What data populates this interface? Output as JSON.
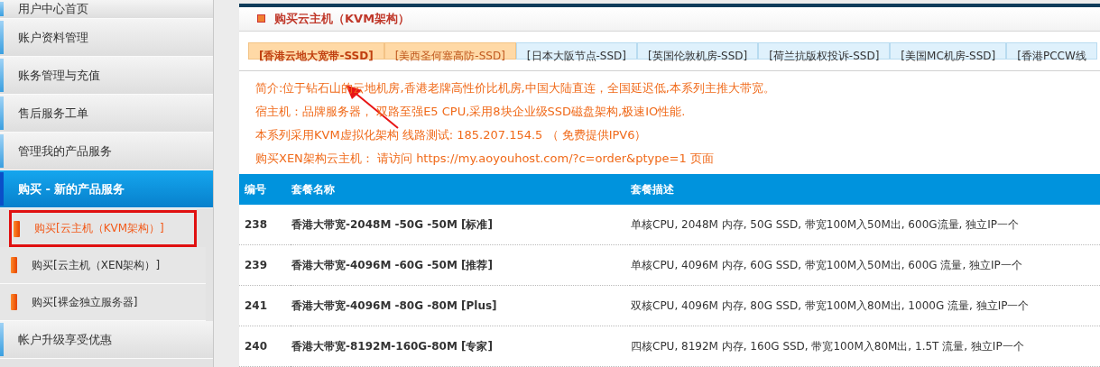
{
  "sidebar": {
    "items": [
      {
        "label": "用户中心首页",
        "kind": "main",
        "selected": false,
        "outlined": false
      },
      {
        "label": "账户资料管理",
        "kind": "main",
        "selected": false,
        "outlined": false
      },
      {
        "label": "账务管理与充值",
        "kind": "main",
        "selected": false,
        "outlined": false
      },
      {
        "label": "售后服务工单",
        "kind": "main",
        "selected": false,
        "outlined": false
      },
      {
        "label": "管理我的产品服务",
        "kind": "main",
        "selected": false,
        "outlined": false
      },
      {
        "label": "购买 - 新的产品服务",
        "kind": "main",
        "selected": true,
        "outlined": false
      },
      {
        "label": "购买[云主机（KVM架构）]",
        "kind": "sub",
        "selected": true,
        "outlined": true
      },
      {
        "label": "购买[云主机（XEN架构）]",
        "kind": "sub",
        "selected": false,
        "outlined": false
      },
      {
        "label": "购买[裸金独立服务器]",
        "kind": "sub",
        "selected": false,
        "outlined": false
      },
      {
        "label": "帐户升级享受优惠",
        "kind": "main",
        "selected": false,
        "outlined": false
      }
    ]
  },
  "panel": {
    "title": "购买云主机（KVM架构）",
    "tabs": [
      {
        "label": "[香港云地大宽带-SSD]",
        "selected": true,
        "highlighted": true
      },
      {
        "label": "[美西圣何塞高防-SSD]",
        "selected": false,
        "highlighted": true
      },
      {
        "label": "[日本大阪节点-SSD]",
        "selected": false,
        "highlighted": false
      },
      {
        "label": "[英国伦敦机房-SSD]",
        "selected": false,
        "highlighted": false
      },
      {
        "label": "[荷兰抗版权投诉-SSD]",
        "selected": false,
        "highlighted": false
      },
      {
        "label": "[美国MC机房-SSD]",
        "selected": false,
        "highlighted": false
      },
      {
        "label": "[香港PCCW线",
        "selected": false,
        "highlighted": false
      }
    ],
    "intro": [
      {
        "text": "简介:位于钻石山的云地机房,香港老牌高性价比机房,中国大陆直连，全国延迟低,本系列主推大带宽。"
      },
      {
        "text": "宿主机：品牌服务器， 双路至强E5 CPU,采用8块企业级SSD磁盘架构,极速IO性能."
      },
      {
        "text": "本系列采用KVM虚拟化架构 线路测试: 185.207.154.5 （ 免费提供IPV6）"
      },
      {
        "text": "购买XEN架构云主机： 请访问",
        "link": "https://my.aoyouhost.com/?c=order&ptype=1",
        "suffix": "页面"
      }
    ],
    "table": {
      "columns": [
        "编号",
        "套餐名称",
        "套餐描述"
      ],
      "rows": [
        [
          "238",
          "香港大带宽-2048M -50G -50M [标准]",
          "单核CPU, 2048M 内存, 50G SSD, 带宽100M入50M出, 600G流量, 独立IP一个"
        ],
        [
          "239",
          "香港大带宽-4096M -60G -50M [推荐]",
          "单核CPU, 4096M 内存, 60G SSD, 带宽100M入50M出, 600G 流量, 独立IP一个"
        ],
        [
          "241",
          "香港大带宽-4096M -80G -80M [Plus]",
          "双核CPU, 4096M 内存, 80G SSD, 带宽100M入80M出, 1000G 流量, 独立IP一个"
        ],
        [
          "240",
          "香港大带宽-8192M-160G-80M [专家]",
          "四核CPU, 8192M 内存, 160G SSD, 带宽100M入80M出, 1.5T 流量, 独立IP一个"
        ]
      ]
    }
  }
}
